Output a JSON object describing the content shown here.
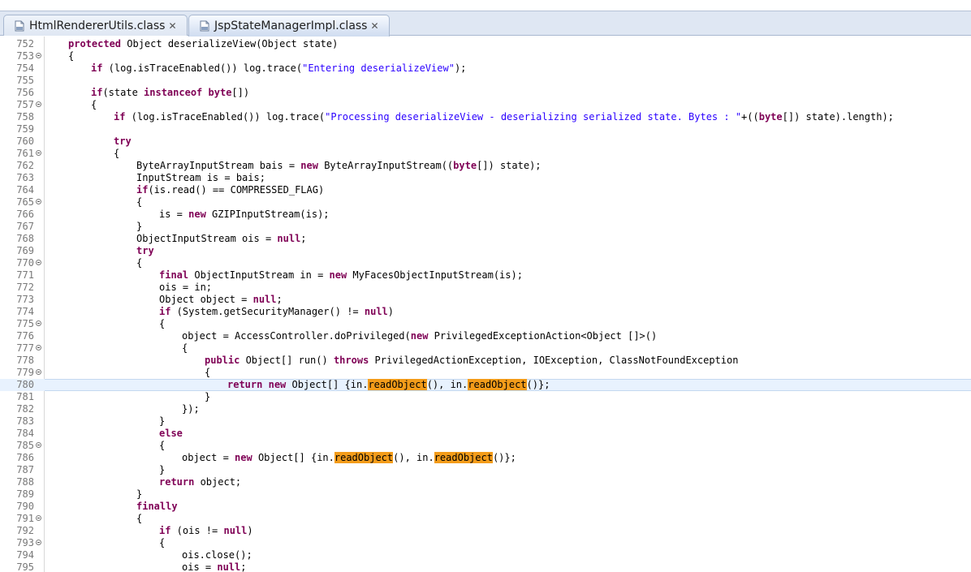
{
  "tabs": [
    {
      "label": "HtmlRendererUtils.class",
      "active": false
    },
    {
      "label": "JspStateManagerImpl.class",
      "active": true
    }
  ],
  "code_lines": [
    {
      "num": "752",
      "fold": false,
      "indent": 1,
      "tokens": [
        [
          "kw",
          "protected"
        ],
        [
          "t",
          " Object deserializeView(Object state)"
        ]
      ]
    },
    {
      "num": "753",
      "fold": true,
      "indent": 1,
      "tokens": [
        [
          "t",
          "{"
        ]
      ]
    },
    {
      "num": "754",
      "fold": false,
      "indent": 2,
      "tokens": [
        [
          "kw",
          "if"
        ],
        [
          "t",
          " (log.isTraceEnabled()) log.trace("
        ],
        [
          "str",
          "\"Entering deserializeView\""
        ],
        [
          "t",
          ");"
        ]
      ]
    },
    {
      "num": "755",
      "fold": false,
      "indent": 0,
      "tokens": []
    },
    {
      "num": "756",
      "fold": false,
      "indent": 2,
      "tokens": [
        [
          "kw",
          "if"
        ],
        [
          "t",
          "(state "
        ],
        [
          "kw",
          "instanceof"
        ],
        [
          "t",
          " "
        ],
        [
          "kw",
          "byte"
        ],
        [
          "t",
          "[])"
        ]
      ]
    },
    {
      "num": "757",
      "fold": true,
      "indent": 2,
      "tokens": [
        [
          "t",
          "{"
        ]
      ]
    },
    {
      "num": "758",
      "fold": false,
      "indent": 3,
      "tokens": [
        [
          "kw",
          "if"
        ],
        [
          "t",
          " (log.isTraceEnabled()) log.trace("
        ],
        [
          "str",
          "\"Processing deserializeView - deserializing serialized state. Bytes : \""
        ],
        [
          "t",
          "+(("
        ],
        [
          "kw",
          "byte"
        ],
        [
          "t",
          "[]) state).length);"
        ]
      ]
    },
    {
      "num": "759",
      "fold": false,
      "indent": 0,
      "tokens": []
    },
    {
      "num": "760",
      "fold": false,
      "indent": 3,
      "tokens": [
        [
          "kw",
          "try"
        ]
      ]
    },
    {
      "num": "761",
      "fold": true,
      "indent": 3,
      "tokens": [
        [
          "t",
          "{"
        ]
      ]
    },
    {
      "num": "762",
      "fold": false,
      "indent": 4,
      "tokens": [
        [
          "t",
          "ByteArrayInputStream bais = "
        ],
        [
          "kw",
          "new"
        ],
        [
          "t",
          " ByteArrayInputStream(("
        ],
        [
          "kw",
          "byte"
        ],
        [
          "t",
          "[]) state);"
        ]
      ]
    },
    {
      "num": "763",
      "fold": false,
      "indent": 4,
      "tokens": [
        [
          "t",
          "InputStream is = bais;"
        ]
      ]
    },
    {
      "num": "764",
      "fold": false,
      "indent": 4,
      "tokens": [
        [
          "kw",
          "if"
        ],
        [
          "t",
          "(is.read() == COMPRESSED_FLAG)"
        ]
      ]
    },
    {
      "num": "765",
      "fold": true,
      "indent": 4,
      "tokens": [
        [
          "t",
          "{"
        ]
      ]
    },
    {
      "num": "766",
      "fold": false,
      "indent": 5,
      "tokens": [
        [
          "t",
          "is = "
        ],
        [
          "kw",
          "new"
        ],
        [
          "t",
          " GZIPInputStream(is);"
        ]
      ]
    },
    {
      "num": "767",
      "fold": false,
      "indent": 4,
      "tokens": [
        [
          "t",
          "}"
        ]
      ]
    },
    {
      "num": "768",
      "fold": false,
      "indent": 4,
      "tokens": [
        [
          "t",
          "ObjectInputStream ois = "
        ],
        [
          "kw",
          "null"
        ],
        [
          "t",
          ";"
        ]
      ]
    },
    {
      "num": "769",
      "fold": false,
      "indent": 4,
      "tokens": [
        [
          "kw",
          "try"
        ]
      ]
    },
    {
      "num": "770",
      "fold": true,
      "indent": 4,
      "tokens": [
        [
          "t",
          "{"
        ]
      ]
    },
    {
      "num": "771",
      "fold": false,
      "indent": 5,
      "tokens": [
        [
          "kw",
          "final"
        ],
        [
          "t",
          " ObjectInputStream in = "
        ],
        [
          "kw",
          "new"
        ],
        [
          "t",
          " MyFacesObjectInputStream(is);"
        ]
      ]
    },
    {
      "num": "772",
      "fold": false,
      "indent": 5,
      "tokens": [
        [
          "t",
          "ois = in;"
        ]
      ]
    },
    {
      "num": "773",
      "fold": false,
      "indent": 5,
      "tokens": [
        [
          "t",
          "Object object = "
        ],
        [
          "kw",
          "null"
        ],
        [
          "t",
          ";"
        ]
      ]
    },
    {
      "num": "774",
      "fold": false,
      "indent": 5,
      "tokens": [
        [
          "kw",
          "if"
        ],
        [
          "t",
          " (System.getSecurityManager() != "
        ],
        [
          "kw",
          "null"
        ],
        [
          "t",
          ")"
        ]
      ]
    },
    {
      "num": "775",
      "fold": true,
      "indent": 5,
      "tokens": [
        [
          "t",
          "{"
        ]
      ]
    },
    {
      "num": "776",
      "fold": false,
      "indent": 6,
      "tokens": [
        [
          "t",
          "object = AccessController.doPrivileged("
        ],
        [
          "kw",
          "new"
        ],
        [
          "t",
          " PrivilegedExceptionAction<Object []>()"
        ]
      ]
    },
    {
      "num": "777",
      "fold": true,
      "indent": 6,
      "tokens": [
        [
          "t",
          "{"
        ]
      ]
    },
    {
      "num": "778",
      "fold": false,
      "indent": 7,
      "tokens": [
        [
          "kw",
          "public"
        ],
        [
          "t",
          " Object[] run() "
        ],
        [
          "kw",
          "throws"
        ],
        [
          "t",
          " PrivilegedActionException, IOException, ClassNotFoundException"
        ]
      ]
    },
    {
      "num": "779",
      "fold": true,
      "indent": 7,
      "tokens": [
        [
          "t",
          "{"
        ]
      ]
    },
    {
      "num": "780",
      "fold": false,
      "indent": 8,
      "current": true,
      "tokens": [
        [
          "kw",
          "return"
        ],
        [
          "t",
          " "
        ],
        [
          "kw",
          "new"
        ],
        [
          "t",
          " Object[] {in."
        ],
        [
          "hl",
          "readObject"
        ],
        [
          "t",
          "(), in."
        ],
        [
          "hl",
          "readObject"
        ],
        [
          "t",
          "()};"
        ]
      ]
    },
    {
      "num": "781",
      "fold": false,
      "indent": 7,
      "tokens": [
        [
          "t",
          "}"
        ]
      ]
    },
    {
      "num": "782",
      "fold": false,
      "indent": 6,
      "tokens": [
        [
          "t",
          "});"
        ]
      ]
    },
    {
      "num": "783",
      "fold": false,
      "indent": 5,
      "tokens": [
        [
          "t",
          "}"
        ]
      ]
    },
    {
      "num": "784",
      "fold": false,
      "indent": 5,
      "tokens": [
        [
          "kw",
          "else"
        ]
      ]
    },
    {
      "num": "785",
      "fold": true,
      "indent": 5,
      "tokens": [
        [
          "t",
          "{"
        ]
      ]
    },
    {
      "num": "786",
      "fold": false,
      "indent": 6,
      "tokens": [
        [
          "t",
          "object = "
        ],
        [
          "kw",
          "new"
        ],
        [
          "t",
          " Object[] {in."
        ],
        [
          "hl",
          "readObject"
        ],
        [
          "t",
          "(), in."
        ],
        [
          "hl",
          "readObject"
        ],
        [
          "t",
          "()};"
        ]
      ]
    },
    {
      "num": "787",
      "fold": false,
      "indent": 5,
      "tokens": [
        [
          "t",
          "}"
        ]
      ]
    },
    {
      "num": "788",
      "fold": false,
      "indent": 5,
      "tokens": [
        [
          "kw",
          "return"
        ],
        [
          "t",
          " object;"
        ]
      ]
    },
    {
      "num": "789",
      "fold": false,
      "indent": 4,
      "tokens": [
        [
          "t",
          "}"
        ]
      ]
    },
    {
      "num": "790",
      "fold": false,
      "indent": 4,
      "tokens": [
        [
          "kw",
          "finally"
        ]
      ]
    },
    {
      "num": "791",
      "fold": true,
      "indent": 4,
      "tokens": [
        [
          "t",
          "{"
        ]
      ]
    },
    {
      "num": "792",
      "fold": false,
      "indent": 5,
      "tokens": [
        [
          "kw",
          "if"
        ],
        [
          "t",
          " (ois != "
        ],
        [
          "kw",
          "null"
        ],
        [
          "t",
          ")"
        ]
      ]
    },
    {
      "num": "793",
      "fold": true,
      "indent": 5,
      "tokens": [
        [
          "t",
          "{"
        ]
      ]
    },
    {
      "num": "794",
      "fold": false,
      "indent": 6,
      "tokens": [
        [
          "t",
          "ois.close();"
        ]
      ]
    },
    {
      "num": "795",
      "fold": false,
      "indent": 6,
      "tokens": [
        [
          "t",
          "ois = "
        ],
        [
          "kw",
          "null"
        ],
        [
          "t",
          ";"
        ]
      ]
    }
  ]
}
